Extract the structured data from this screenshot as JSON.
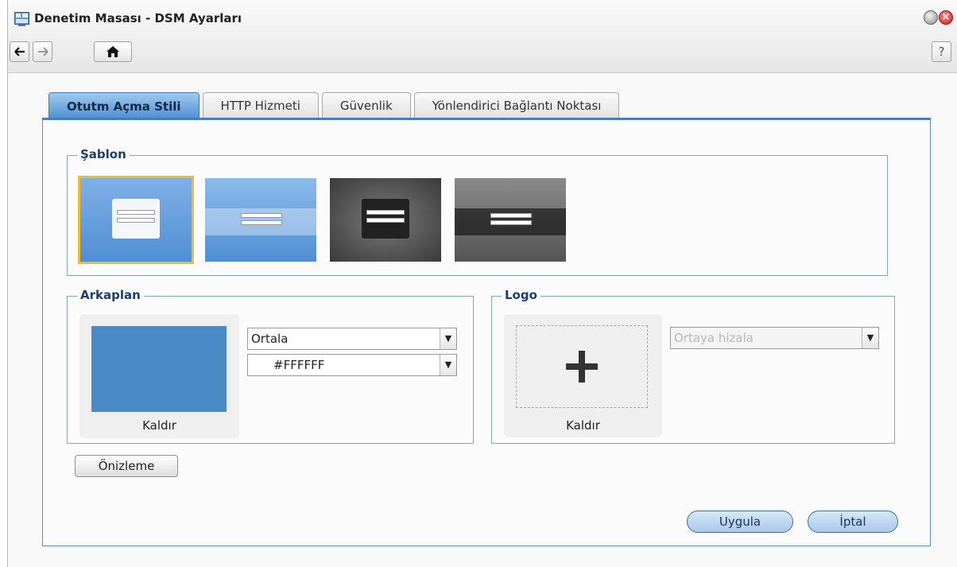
{
  "window": {
    "title": "Denetim Masası - DSM Ayarları",
    "help_label": "?"
  },
  "tabs": [
    {
      "label": "Otutm Açma Stili",
      "active": true
    },
    {
      "label": "HTTP Hizmeti",
      "active": false
    },
    {
      "label": "Güvenlik",
      "active": false
    },
    {
      "label": "Yönlendirici Bağlantı Noktası",
      "active": false
    }
  ],
  "template": {
    "legend": "Şablon",
    "selected_index": 0
  },
  "background": {
    "legend": "Arkaplan",
    "position_select": "Ortala",
    "color_select": "#FFFFFF",
    "remove_label": "Kaldır",
    "swatch_color": "#4a8bc6"
  },
  "logo": {
    "legend": "Logo",
    "align_select": "Ortaya hizala",
    "remove_label": "Kaldır"
  },
  "buttons": {
    "preview": "Önizleme",
    "apply": "Uygula",
    "cancel": "İptal"
  },
  "colors": {
    "accent": "#4a7cbf",
    "selected_outline": "#f2bb2a",
    "close_red": "#d21b1b"
  }
}
